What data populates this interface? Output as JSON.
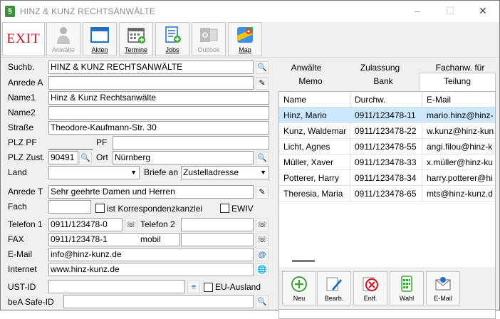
{
  "window": {
    "title": "HINZ & KUNZ RECHTSANWÄLTE",
    "app_icon_glyph": "§",
    "controls": {
      "minimize": "–",
      "maximize": "☐",
      "close": "✕"
    }
  },
  "toolbar": {
    "exit": "EXIT",
    "anwaelte": "Anwälte",
    "akten": "Akten",
    "termine": "Termine",
    "jobs": "Jobs",
    "outlook": "Outlook",
    "map": "Map"
  },
  "form": {
    "suchb": {
      "label": "Suchb.",
      "value": "HINZ & KUNZ RECHTSANWÄLTE"
    },
    "anrede_a": {
      "label": "Anrede A",
      "value": ""
    },
    "name1": {
      "label": "Name1",
      "value": "Hinz & Kunz Rechtsanwälte"
    },
    "name2": {
      "label": "Name2",
      "value": ""
    },
    "strasse": {
      "label": "Straße",
      "value": "Theodore-Kaufmann-Str. 30"
    },
    "plz_pf": {
      "label": "PLZ PF",
      "value": "",
      "pf_label": "PF",
      "pf_value": ""
    },
    "plz_zust": {
      "label": "PLZ Zust.",
      "value": "90491",
      "ort_label": "Ort",
      "ort_value": "Nürnberg"
    },
    "land": {
      "label": "Land",
      "value": "",
      "briefe_label": "Briefe an",
      "briefe_value": "Zustelladresse"
    },
    "anrede_t": {
      "label": "Anrede T",
      "value": "Sehr geehrte Damen und Herren"
    },
    "fach": {
      "label": "Fach",
      "value": "",
      "korrespondenz_label": "ist Korrespondenzkanzlei",
      "ewiv_label": "EWIV"
    },
    "telefon1": {
      "label": "Telefon 1",
      "value": "0911/123478-0",
      "telefon2_label": "Telefon 2",
      "telefon2_value": ""
    },
    "fax": {
      "label": "FAX",
      "value": "0911/123478-1",
      "mobil_label": "mobil",
      "mobil_value": ""
    },
    "email": {
      "label": "E-Mail",
      "value": "info@hinz-kunz.de"
    },
    "internet": {
      "label": "Internet",
      "value": "www.hinz-kunz.de"
    },
    "ust_id": {
      "label": "UST-ID",
      "value": "",
      "eu_label": "EU-Ausland"
    },
    "bea": {
      "label": "beA Safe-ID",
      "value": ""
    }
  },
  "tabs": {
    "row1": [
      "Anwälte",
      "Zulassung",
      "Fachanw. für"
    ],
    "row2": [
      "Memo",
      "Bank",
      "Teilung"
    ],
    "active": "Teilung"
  },
  "grid": {
    "headers": [
      "Name",
      "Durchw.",
      "E-Mail"
    ],
    "rows": [
      [
        "Hinz, Mario",
        "0911/123478-11",
        "mario.hinz@hinz-"
      ],
      [
        "Kunz, Waldemar",
        "0911/123478-22",
        "w.kunz@hinz-kun"
      ],
      [
        "Licht, Agnes",
        "0911/123478-55",
        "angi.filou@hinz-k"
      ],
      [
        "Müller, Xaver",
        "0911/123478-33",
        "x.müller@hinz-ku"
      ],
      [
        "Potterer, Harry",
        "0911/123478-34",
        "harry.potterer@hi"
      ],
      [
        "Theresia, Maria",
        "0911/123478-65",
        "mts@hinz-kunz.d"
      ]
    ],
    "selected_row": 0
  },
  "actions": {
    "neu": "Neu",
    "bearb": "Bearb.",
    "entf": "Entf.",
    "wahl": "Wahl",
    "email": "E-Mail"
  }
}
